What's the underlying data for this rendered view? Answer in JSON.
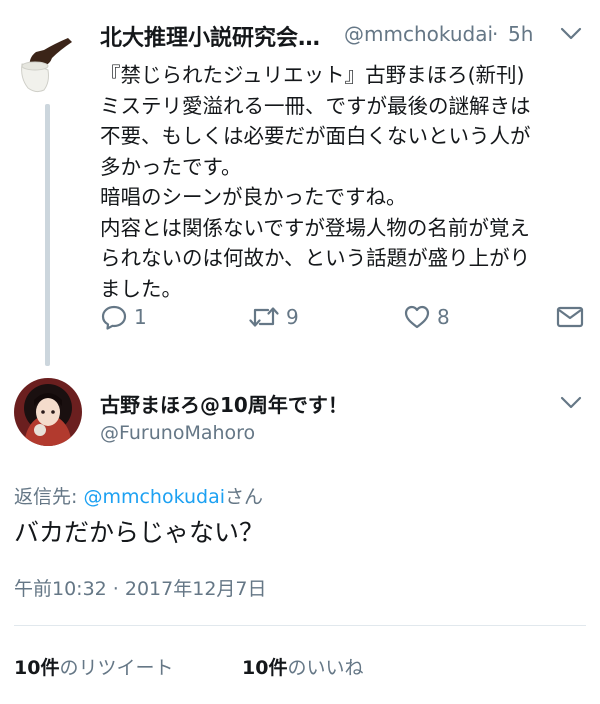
{
  "parent_tweet": {
    "display_name": "北大推理小説研究会…",
    "handle": "@mmchokudai",
    "separator": "·",
    "time": "5h",
    "lines": [
      "『禁じられたジュリエット』古野まほろ(新刊)",
      "ミステリ愛溢れる一冊、ですが最後の謎解きは",
      "不要、もしくは必要だが面白くないという人が",
      "多かったです。",
      "暗唱のシーンが良かったですね。",
      "内容とは関係ないですが登場人物の名前が覚え",
      "られないのは何故か、という話題が盛り上がり",
      "ました。"
    ],
    "actions": {
      "reply_count": "1",
      "retweet_count": "9",
      "like_count": "8"
    },
    "icons": [
      "pipe-avatar-icon",
      "chevron-down-icon",
      "reply-icon",
      "retweet-icon",
      "heart-icon",
      "mail-icon"
    ]
  },
  "main_tweet": {
    "display_name": "古野まほろ@10周年です！",
    "handle": "@FurunoMahoro",
    "reply_prefix": "返信先: ",
    "reply_mention": "@mmchokudai",
    "reply_suffix": "さん",
    "text": "バカだからじゃない？",
    "timestamp": "午前10:32 · 2017年12月7日",
    "retweets_count": "10件",
    "retweets_label": "のリツイート",
    "likes_count": "10件",
    "likes_label": "のいいね"
  },
  "colors": {
    "text": "#14171a",
    "secondary": "#657786",
    "link": "#1da1f2",
    "thread_line": "#ccd6dd",
    "divider": "#e1e8ed"
  }
}
